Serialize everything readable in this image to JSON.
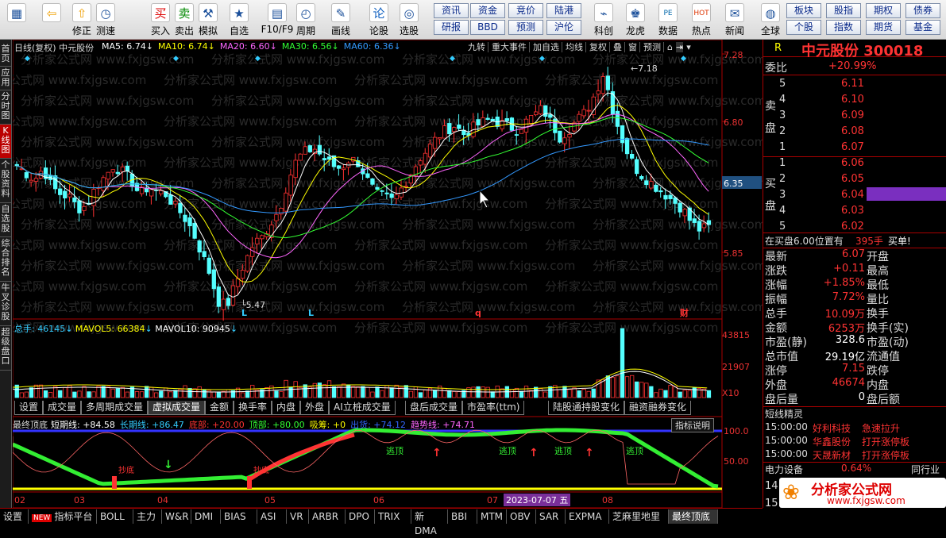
{
  "toolbar": {
    "buttons": [
      {
        "label": "",
        "icon": "grid-icon"
      },
      {
        "label": "",
        "icon": "back-arrow-icon"
      },
      {
        "label": "修正",
        "icon": "up-arrow-icon"
      },
      {
        "label": "测速",
        "icon": "clock-icon"
      },
      {
        "label": "买入",
        "icon": "buy-icon",
        "text": "买"
      },
      {
        "label": "卖出",
        "icon": "sell-icon",
        "text": "卖"
      },
      {
        "label": "模拟",
        "icon": "hammer-icon"
      },
      {
        "label": "自选",
        "icon": "star-folder-icon"
      },
      {
        "label": "F10/F9",
        "icon": "f10-icon"
      },
      {
        "label": "周期",
        "icon": "period-icon"
      },
      {
        "label": "画线",
        "icon": "pencil-icon"
      },
      {
        "label": "论股",
        "icon": "discuss-icon",
        "text": "论"
      },
      {
        "label": "选股",
        "icon": "select-stock-icon"
      },
      {
        "label": "科创",
        "icon": "star-market-icon"
      },
      {
        "label": "龙虎",
        "icon": "dragon-tiger-icon"
      },
      {
        "label": "数据",
        "icon": "pe-icon",
        "text": "PE"
      },
      {
        "label": "热点",
        "icon": "hot-icon",
        "text": "HOT"
      },
      {
        "label": "新闻",
        "icon": "news-icon"
      },
      {
        "label": "全球",
        "icon": "globe-icon"
      }
    ],
    "small_buttons": [
      [
        "资讯",
        "研报"
      ],
      [
        "资金",
        "BBD"
      ],
      [
        "竞价",
        "预测"
      ],
      [
        "陆港",
        "沪伦"
      ],
      [
        "板块",
        "个股"
      ],
      [
        "股指",
        "指数"
      ],
      [
        "期权",
        "期货"
      ],
      [
        "债券",
        "基金"
      ]
    ]
  },
  "sidebar": [
    {
      "label": "首页",
      "active": false
    },
    {
      "label": "应用",
      "active": false
    },
    {
      "label": "分时图",
      "active": false
    },
    {
      "label": "K线图",
      "active": true
    },
    {
      "label": "个股资料",
      "active": false
    },
    {
      "label": "自选股",
      "active": false
    },
    {
      "label": "综合排名",
      "active": false
    },
    {
      "label": "牛叉诊股",
      "active": false
    },
    {
      "label": "超级盘口",
      "active": false
    }
  ],
  "kline": {
    "title": "日线(复权) 中元股份",
    "ma_labels": [
      {
        "text": "MA5: 6.74",
        "color": "#ffffff"
      },
      {
        "text": "MA10: 6.74",
        "color": "#ffff00"
      },
      {
        "text": "MA20: 6.60",
        "color": "#ff66ff"
      },
      {
        "text": "MA30: 6.56",
        "color": "#33ff33"
      },
      {
        "text": "MA60: 6.36",
        "color": "#3399ff"
      }
    ],
    "menu": [
      "九转",
      "重大事件",
      "加自选",
      "均线",
      "复权",
      "叠",
      "窗",
      "预测"
    ],
    "price_axis": [
      "7.28",
      "6.80",
      "6.35",
      "5.85"
    ],
    "high_label": "7.18",
    "low_label": "5.47",
    "markers": [
      "L",
      "L",
      "q",
      "财"
    ],
    "watermark": "分析家公式网 www.fxjgsw.com"
  },
  "volume": {
    "label": "总手: 46145",
    "mavol5": "MAVOL5: 66384",
    "mavol10": "MAVOL10: 90945",
    "axis": [
      "43815",
      "21907",
      "X10"
    ]
  },
  "indicator_tabs": [
    "设置",
    "成交量",
    "多周期成交量",
    "虚拟成交量",
    "金额",
    "换手率",
    "内盘",
    "外盘",
    "AI立桩成交量",
    "盘后成交量",
    "市盈率(ttm)",
    "陆股通持股变化",
    "融资融券变化"
  ],
  "indicator": {
    "name": "最终顶底",
    "items": [
      {
        "text": "短期线: +84.58",
        "color": "#ffffff"
      },
      {
        "text": "长期线: +86.47",
        "color": "#33ccff"
      },
      {
        "text": "底部: +20.00",
        "color": "#ff3333"
      },
      {
        "text": "顶部: +80.00",
        "color": "#33ff33"
      },
      {
        "text": "吸筹: +0",
        "color": "#ffff00"
      },
      {
        "text": "出货: +74.12",
        "color": "#3366ff"
      },
      {
        "text": "趋势线: +74.71",
        "color": "#ff66ff"
      }
    ],
    "explain": "指标说明",
    "axis": [
      "100.0",
      "50.00"
    ],
    "escape": "逃顶",
    "bottom_text": "抄底"
  },
  "dates": [
    "02",
    "03",
    "04",
    "05",
    "06",
    "07",
    "08"
  ],
  "cursor_date": "2023-07-07 五",
  "bottom_tabs": [
    "设置",
    "指标平台",
    "BOLL",
    "主力",
    "W&R",
    "DMI",
    "BIAS",
    "ASI",
    "VR",
    "ARBR",
    "DPO",
    "TRIX",
    "新DMA",
    "BBI",
    "MTM",
    "OBV",
    "SAR",
    "EXPMA",
    "芝麻里地里",
    "最终顶底"
  ],
  "new_badge": "NEW",
  "right_panel": {
    "name": "中元股份",
    "code": "300018",
    "r": "R",
    "weibi": {
      "label": "委比",
      "value": "+20.99%"
    },
    "sell": [
      {
        "n": "5",
        "p": "6.11"
      },
      {
        "n": "4",
        "p": "6.10"
      },
      {
        "n": "3",
        "p": "6.09"
      },
      {
        "n": "2",
        "p": "6.08"
      },
      {
        "n": "1",
        "p": "6.07"
      }
    ],
    "buy": [
      {
        "n": "1",
        "p": "6.06"
      },
      {
        "n": "2",
        "p": "6.05"
      },
      {
        "n": "3",
        "p": "6.04"
      },
      {
        "n": "4",
        "p": "6.03"
      },
      {
        "n": "5",
        "p": "6.02"
      }
    ],
    "sell_label": "卖盘",
    "buy_label": "买盘",
    "bid_info": "在买盘6.00位置有",
    "bid_qty": "395手",
    "bid_tag": "买单!",
    "quotes": [
      {
        "l": "最新",
        "v": "6.07",
        "r": "开盘"
      },
      {
        "l": "涨跌",
        "v": "+0.11",
        "r": "最高"
      },
      {
        "l": "涨幅",
        "v": "+1.85%",
        "r": "最低"
      },
      {
        "l": "振幅",
        "v": "7.72%",
        "r": "量比"
      },
      {
        "l": "总手",
        "v": "10.09万",
        "r": "换手"
      },
      {
        "l": "金额",
        "v": "6253万",
        "r": "换手(实)"
      },
      {
        "l": "市盈(静)",
        "v": "328.6",
        "r": "市盈(动)"
      },
      {
        "l": "总市值",
        "v": "29.19亿",
        "r": "流通值"
      },
      {
        "l": "涨停",
        "v": "7.15",
        "r": "跌停"
      },
      {
        "l": "外盘",
        "v": "46674",
        "r": "内盘"
      },
      {
        "l": "盘后量",
        "v": "0",
        "r": "盘后额"
      }
    ],
    "quotes_right_partial": [
      "2",
      "",
      "4",
      "24.",
      "",
      "5"
    ],
    "sprite_title": "短线精灵",
    "sprites": [
      {
        "t": "15:00:00",
        "n": "好利科技",
        "e": "急速拉升"
      },
      {
        "t": "15:00:00",
        "n": "华鑫股份",
        "e": "打开涨停板"
      },
      {
        "t": "15:00:00",
        "n": "天晟新材",
        "e": "打开涨停板"
      }
    ],
    "sector": "电力设备",
    "sector_pct": "0.64%",
    "sector_right": "同行业",
    "times": [
      "14:",
      "15:"
    ],
    "logo_text": "分析家公式网",
    "logo_url": "www.fxjgsw.com"
  }
}
